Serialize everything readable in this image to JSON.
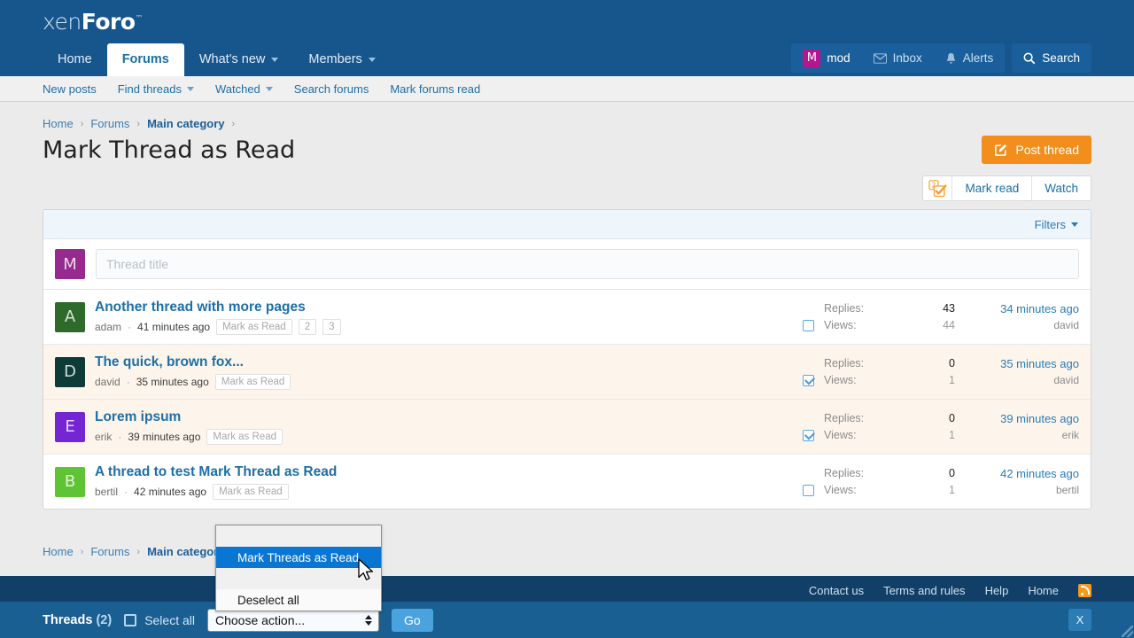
{
  "brand": {
    "name_thin": "xen",
    "name_bold": "Foro",
    "tm": "™"
  },
  "nav": {
    "items": [
      {
        "label": "Home",
        "has_caret": false,
        "active": false
      },
      {
        "label": "Forums",
        "has_caret": false,
        "active": true
      },
      {
        "label": "What's new",
        "has_caret": true,
        "active": false
      },
      {
        "label": "Members",
        "has_caret": true,
        "active": false
      }
    ]
  },
  "user_bar": {
    "avatar_letter": "M",
    "avatar_color": "#b5158f",
    "username": "mod",
    "inbox_label": "Inbox",
    "alerts_label": "Alerts",
    "search_label": "Search"
  },
  "subnav": {
    "items": [
      {
        "label": "New posts",
        "has_caret": false
      },
      {
        "label": "Find threads",
        "has_caret": true
      },
      {
        "label": "Watched",
        "has_caret": true
      },
      {
        "label": "Search forums",
        "has_caret": false
      },
      {
        "label": "Mark forums read",
        "has_caret": false
      }
    ]
  },
  "breadcrumb": {
    "items": [
      {
        "label": "Home",
        "strong": false
      },
      {
        "label": "Forums",
        "strong": false
      },
      {
        "label": "Main category",
        "strong": true
      }
    ],
    "separator": "›"
  },
  "page_title": "Mark Thread as Read",
  "post_thread_label": "Post thread",
  "utility": {
    "badge_count": "2",
    "mark_read_label": "Mark read",
    "watch_label": "Watch"
  },
  "filters_label": "Filters",
  "compose": {
    "avatar_letter": "M",
    "avatar_color": "#962a8e",
    "placeholder": "Thread title",
    "value": ""
  },
  "threads": [
    {
      "avatar_letter": "A",
      "avatar_color": "#2e6b2b",
      "title": "Another thread with more pages",
      "author": "adam",
      "separator": "·",
      "posted": "41 minutes ago",
      "mark_label": "Mark as Read",
      "pages": [
        "2",
        "3"
      ],
      "checked": false,
      "unread": false,
      "replies_label": "Replies:",
      "replies": "43",
      "views_label": "Views:",
      "views": "44",
      "last_when": "34 minutes ago",
      "last_who": "david"
    },
    {
      "avatar_letter": "D",
      "avatar_color": "#0d3b38",
      "title": "The quick, brown fox...",
      "author": "david",
      "separator": "·",
      "posted": "35 minutes ago",
      "mark_label": "Mark as Read",
      "pages": [],
      "checked": true,
      "unread": true,
      "replies_label": "Replies:",
      "replies": "0",
      "views_label": "Views:",
      "views": "1",
      "last_when": "35 minutes ago",
      "last_who": "david"
    },
    {
      "avatar_letter": "E",
      "avatar_color": "#7526d3",
      "title": "Lorem ipsum",
      "author": "erik",
      "separator": "·",
      "posted": "39 minutes ago",
      "mark_label": "Mark as Read",
      "pages": [],
      "checked": true,
      "unread": true,
      "replies_label": "Replies:",
      "replies": "0",
      "views_label": "Views:",
      "views": "1",
      "last_when": "39 minutes ago",
      "last_who": "erik"
    },
    {
      "avatar_letter": "B",
      "avatar_color": "#5ec433",
      "title": "A thread to test Mark Thread as Read",
      "author": "bertil",
      "separator": "·",
      "posted": "42 minutes ago",
      "mark_label": "Mark as Read",
      "pages": [],
      "checked": false,
      "unread": false,
      "replies_label": "Replies:",
      "replies": "0",
      "views_label": "Views:",
      "views": "1",
      "last_when": "42 minutes ago",
      "last_who": "bertil"
    }
  ],
  "footer": {
    "links": [
      "Contact us",
      "Terms and rules",
      "Help",
      "Home"
    ],
    "rss_icon": "rss-icon"
  },
  "action_bar": {
    "threads_label": "Threads",
    "threads_count": "(2)",
    "select_all_label": "Select all",
    "select_value": "Choose action...",
    "go_label": "Go",
    "close_label": "X"
  },
  "select_popup": {
    "options": [
      {
        "label": "",
        "selected": false,
        "blank": true
      },
      {
        "label": "Mark Threads as Read",
        "selected": true,
        "blank": false
      },
      {
        "label": "",
        "selected": false,
        "blank": true
      },
      {
        "label": "Deselect all",
        "selected": false,
        "blank": false
      }
    ]
  }
}
